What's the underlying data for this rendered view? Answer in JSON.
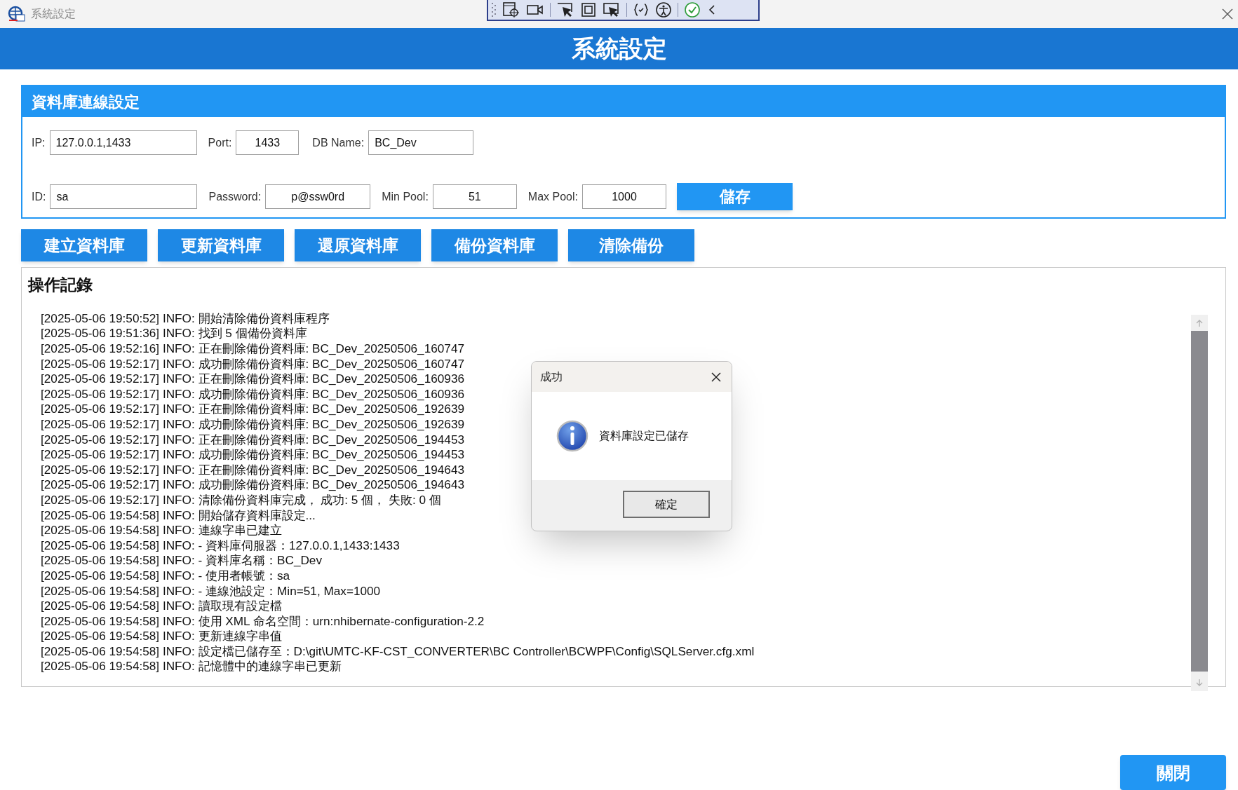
{
  "window": {
    "title": "系統設定"
  },
  "header": {
    "title": "系統設定"
  },
  "db_settings": {
    "title": "資料庫連線設定",
    "rows": [
      [
        {
          "label": "IP:",
          "value": "127.0.0.1,1433",
          "kind": "text"
        },
        {
          "label": "Port:",
          "value": "1433",
          "kind": "number"
        },
        {
          "label": "DB Name:",
          "value": "BC_Dev",
          "kind": "text"
        }
      ],
      [
        {
          "label": "ID:",
          "value": "sa",
          "kind": "text"
        },
        {
          "label": "Password:",
          "value": "p@ssw0rd",
          "kind": "password"
        },
        {
          "label": "Min Pool:",
          "value": "51",
          "kind": "number"
        },
        {
          "label": "Max Pool:",
          "value": "1000",
          "kind": "number"
        }
      ]
    ],
    "save_button": "儲存"
  },
  "actions": [
    "建立資料庫",
    "更新資料庫",
    "還原資料庫",
    "備份資料庫",
    "清除備份"
  ],
  "log": {
    "title": "操作記錄",
    "lines": [
      "[2025-05-06 19:50:52] INFO: 開始清除備份資料庫程序",
      "[2025-05-06 19:51:36] INFO: 找到 5 個備份資料庫",
      "[2025-05-06 19:52:16] INFO: 正在刪除備份資料庫: BC_Dev_20250506_160747",
      "[2025-05-06 19:52:17] INFO: 成功刪除備份資料庫: BC_Dev_20250506_160747",
      "[2025-05-06 19:52:17] INFO: 正在刪除備份資料庫: BC_Dev_20250506_160936",
      "[2025-05-06 19:52:17] INFO: 成功刪除備份資料庫: BC_Dev_20250506_160936",
      "[2025-05-06 19:52:17] INFO: 正在刪除備份資料庫: BC_Dev_20250506_192639",
      "[2025-05-06 19:52:17] INFO: 成功刪除備份資料庫: BC_Dev_20250506_192639",
      "[2025-05-06 19:52:17] INFO: 正在刪除備份資料庫: BC_Dev_20250506_194453",
      "[2025-05-06 19:52:17] INFO: 成功刪除備份資料庫: BC_Dev_20250506_194453",
      "[2025-05-06 19:52:17] INFO: 正在刪除備份資料庫: BC_Dev_20250506_194643",
      "[2025-05-06 19:52:17] INFO: 成功刪除備份資料庫: BC_Dev_20250506_194643",
      "[2025-05-06 19:52:17] INFO: 清除備份資料庫完成， 成功: 5 個， 失敗: 0 個",
      "[2025-05-06 19:54:58] INFO: 開始儲存資料庫設定...",
      "[2025-05-06 19:54:58] INFO: 連線字串已建立",
      "[2025-05-06 19:54:58] INFO: - 資料庫伺服器：127.0.0.1,1433:1433",
      "[2025-05-06 19:54:58] INFO: - 資料庫名稱：BC_Dev",
      "[2025-05-06 19:54:58] INFO: - 使用者帳號：sa",
      "[2025-05-06 19:54:58] INFO: - 連線池設定：Min=51, Max=1000",
      "[2025-05-06 19:54:58] INFO: 讀取現有設定檔",
      "[2025-05-06 19:54:58] INFO: 使用 XML 命名空間：urn:nhibernate-configuration-2.2",
      "[2025-05-06 19:54:58] INFO: 更新連線字串值",
      "[2025-05-06 19:54:58] INFO: 設定檔已儲存至：D:\\git\\UMTC-KF-CST_CONVERTER\\BC Controller\\BCWPF\\Config\\SQLServer.cfg.xml",
      "[2025-05-06 19:54:58] INFO: 記憶體中的連線字串已更新"
    ]
  },
  "dialog": {
    "title": "成功",
    "message": "資料庫設定已儲存",
    "button": "確定"
  },
  "close_button": "關閉"
}
